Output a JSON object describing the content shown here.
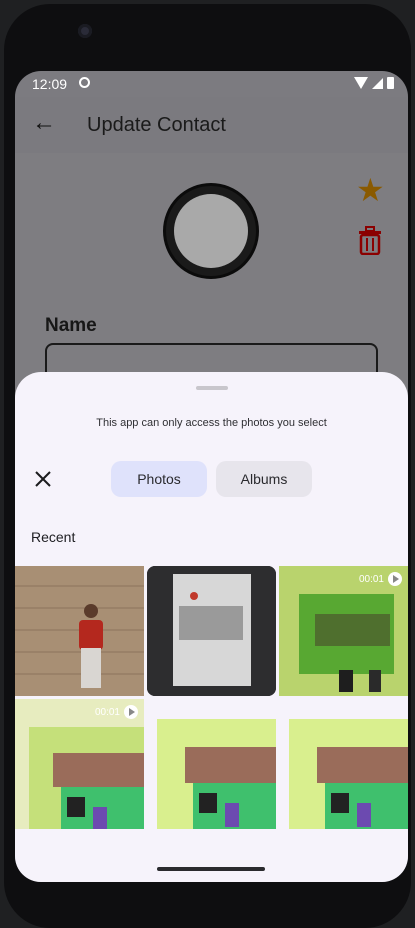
{
  "status_bar": {
    "time": "12:09"
  },
  "app_bar": {
    "title": "Update Contact",
    "back_icon": "arrow-back-icon"
  },
  "form": {
    "name_label": "Name"
  },
  "actions": {
    "favorite_icon": "star-icon",
    "delete_icon": "trash-icon",
    "favorite_color": "#8a5a00",
    "delete_color": "#8b0000"
  },
  "picker": {
    "notice": "This app can only access the photos you select",
    "tabs": [
      {
        "label": "Photos",
        "selected": true
      },
      {
        "label": "Albums",
        "selected": false
      }
    ],
    "section": "Recent",
    "items": [
      {
        "type": "photo"
      },
      {
        "type": "photo"
      },
      {
        "type": "video",
        "duration": "00:01"
      },
      {
        "type": "video",
        "duration": "00:01"
      },
      {
        "type": "photo"
      },
      {
        "type": "photo"
      }
    ]
  }
}
